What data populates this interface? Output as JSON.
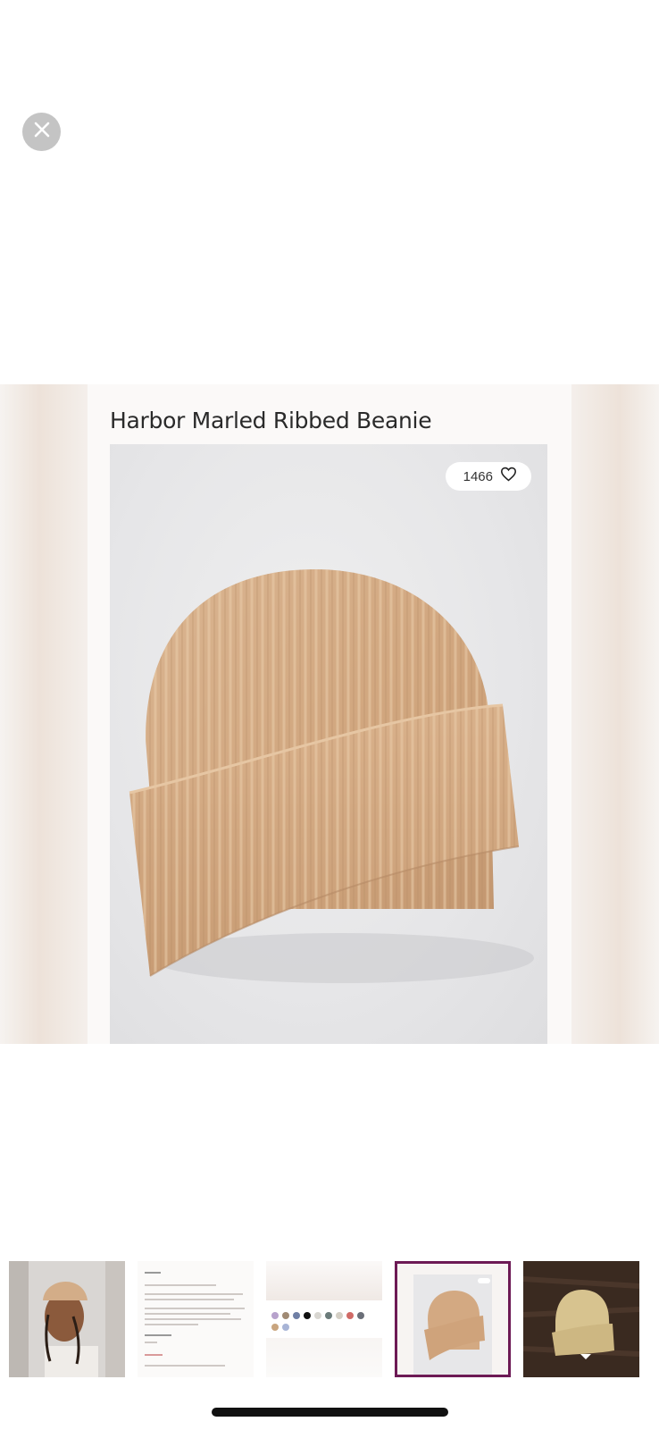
{
  "product": {
    "title": "Harbor Marled Ribbed Beanie",
    "like_count": "1466"
  },
  "icons": {
    "close": "close-icon",
    "like": "heart-icon"
  },
  "colors": {
    "hat": "#d3a982",
    "photo_bg": "#e6e6e8",
    "selected_border": "#6d1a55",
    "close_bg": "#c4c4c4"
  },
  "thumbnails": [
    {
      "name": "model-wearing-beanie"
    },
    {
      "name": "product-details"
    },
    {
      "name": "color-swatches"
    },
    {
      "name": "beanie-product-shot",
      "selected": true
    },
    {
      "name": "beanie-on-wood-floor"
    }
  ]
}
